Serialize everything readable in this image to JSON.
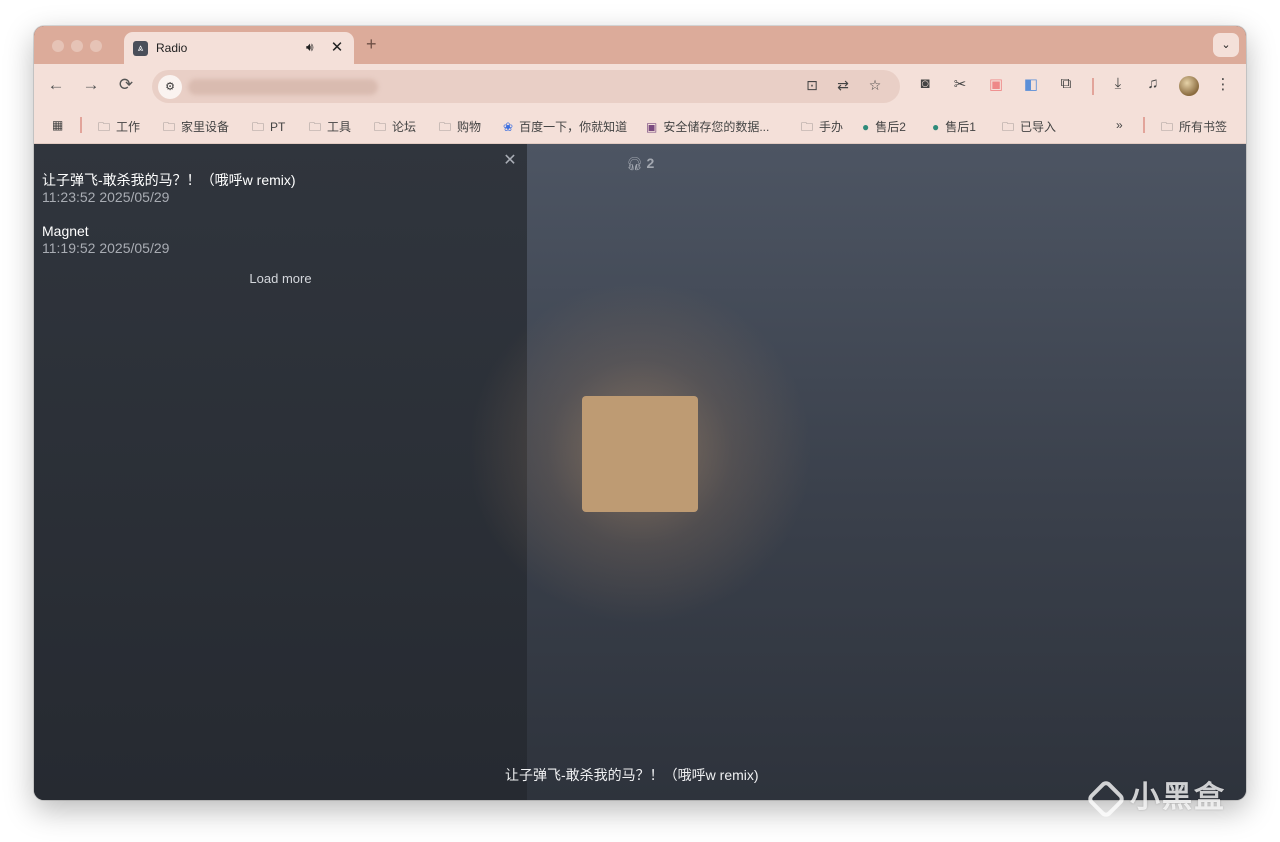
{
  "tab": {
    "title": "Radio",
    "favicon": "radio-app-icon",
    "audio_icon": "speaker-icon"
  },
  "toolbar": {
    "back": "←",
    "forward": "→",
    "reload": "⟳",
    "more": "⋮"
  },
  "bookmarks": {
    "items": [
      {
        "label": "工作",
        "icon": "folder-icon"
      },
      {
        "label": "家里设备",
        "icon": "folder-icon"
      },
      {
        "label": "PT",
        "icon": "folder-icon"
      },
      {
        "label": "工具",
        "icon": "folder-icon"
      },
      {
        "label": "论坛",
        "icon": "folder-icon"
      },
      {
        "label": "购物",
        "icon": "folder-icon"
      },
      {
        "label": "百度一下，你就知道",
        "icon": "baidu-icon"
      },
      {
        "label": "安全储存您的数据...",
        "icon": "site-icon"
      },
      {
        "label": "手办",
        "icon": "folder-icon"
      },
      {
        "label": "售后2",
        "icon": "site-icon"
      },
      {
        "label": "售后1",
        "icon": "site-icon"
      },
      {
        "label": "已导入",
        "icon": "folder-icon"
      }
    ],
    "overflow": "»",
    "all_bookmarks": "所有书签"
  },
  "history": {
    "items": [
      {
        "title": "让子弹飞-敢杀我的马？！（哦呼w remix)",
        "time": "11:23:52 2025/05/29"
      },
      {
        "title": "Magnet",
        "time": "11:19:52 2025/05/29"
      }
    ],
    "load_more": "Load more"
  },
  "player": {
    "listeners": "2",
    "now_playing": "让子弹飞-敢杀我的马？！（哦呼w remix)"
  },
  "watermark": "小黑盒",
  "colors": {
    "tabstrip": "#dcab9a",
    "toolbar": "#f4e0d9",
    "cover": "#be9b73",
    "panel": "#2b3038"
  }
}
